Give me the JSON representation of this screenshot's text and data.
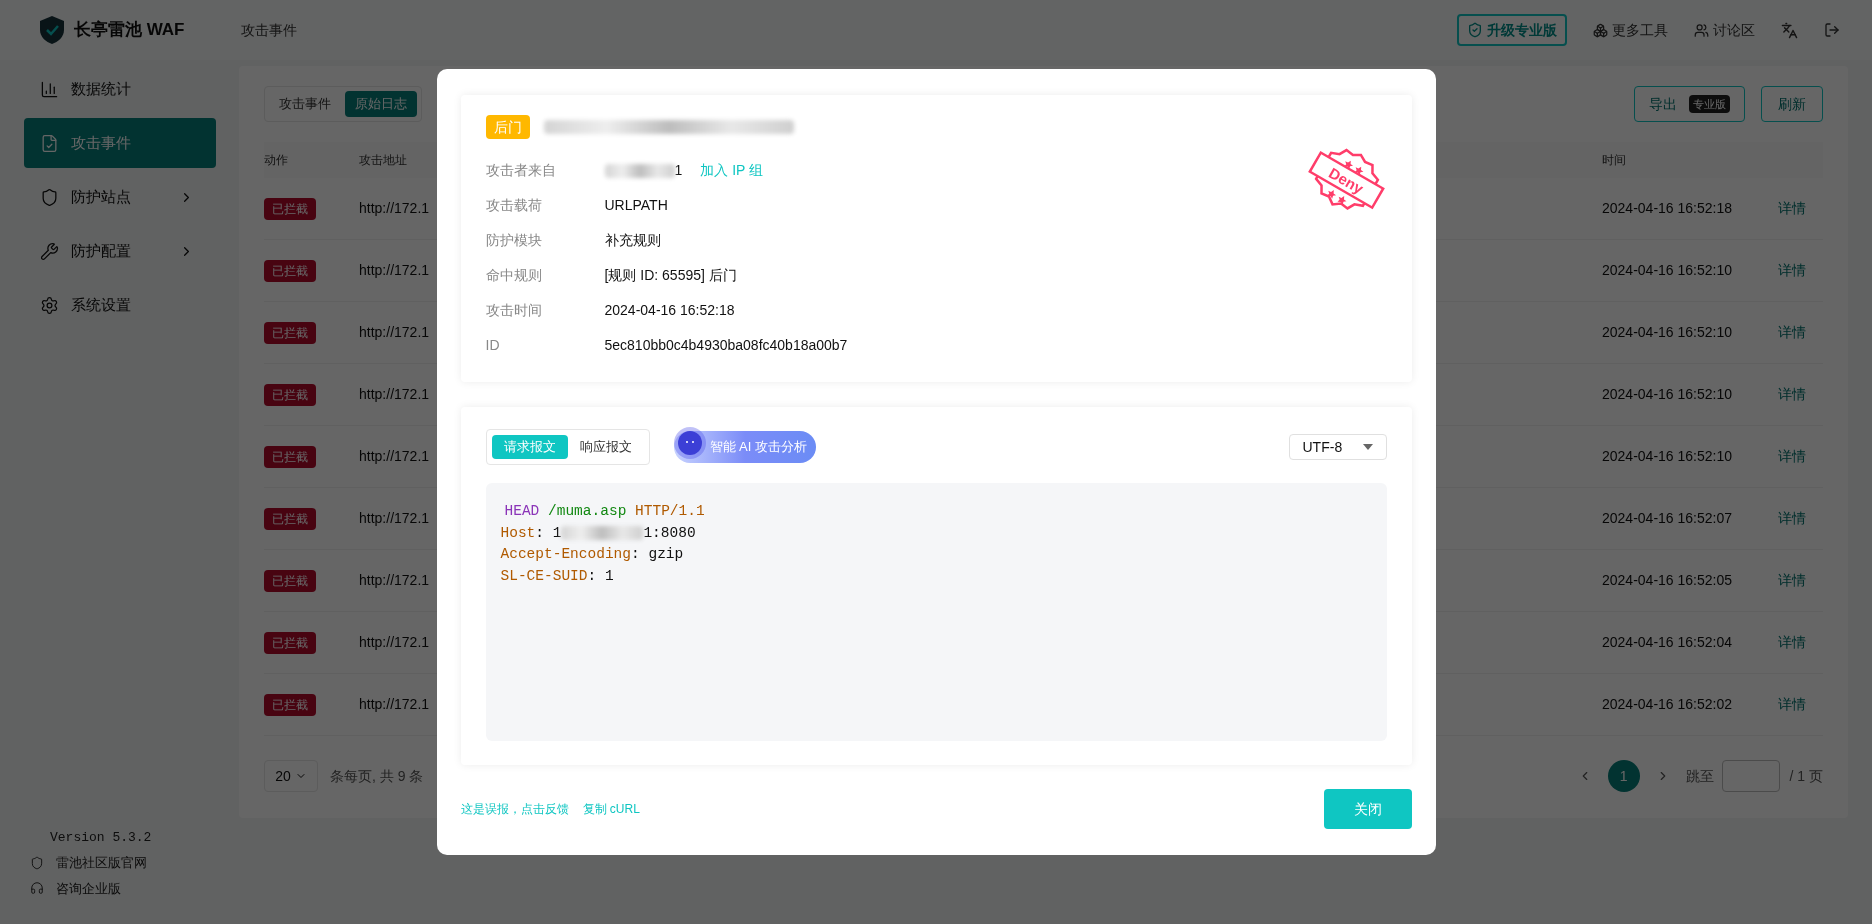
{
  "topbar": {
    "logo_text": "长亭雷池 WAF",
    "breadcrumb": "攻击事件",
    "actions": [
      {
        "kind": "upgrade",
        "label": "升级专业版"
      },
      {
        "kind": "tools",
        "label": "更多工具"
      },
      {
        "kind": "forum",
        "label": "讨论区"
      },
      {
        "kind": "language"
      },
      {
        "kind": "logout"
      }
    ]
  },
  "sidebar": {
    "items": [
      {
        "kind": "chart",
        "label": "数据统计",
        "expandable": false,
        "selected": false
      },
      {
        "kind": "file",
        "label": "攻击事件",
        "expandable": false,
        "selected": true
      },
      {
        "kind": "shield",
        "label": "防护站点",
        "expandable": true,
        "selected": false
      },
      {
        "kind": "tools",
        "label": "防护配置",
        "expandable": true,
        "selected": false
      },
      {
        "kind": "gear",
        "label": "系统设置",
        "expandable": false,
        "selected": false
      }
    ],
    "version": "Version 5.3.2",
    "links": [
      {
        "kind": "shield",
        "label": "雷池社区版官网"
      },
      {
        "kind": "headset",
        "label": "咨询企业版"
      }
    ]
  },
  "toolbar": {
    "tabs": [
      {
        "label": "攻击事件",
        "selected": false
      },
      {
        "label": "原始日志",
        "selected": true
      }
    ],
    "export": {
      "label": "导出",
      "badge": "专业版"
    },
    "refresh": "刷新"
  },
  "table": {
    "columns": [
      {
        "label": "动作"
      },
      {
        "label": "攻击地址"
      },
      {
        "label": "时间"
      }
    ],
    "rows": [
      {
        "action": "已拦截",
        "address": "http://172.1",
        "time": "2024-04-16 16:52:18",
        "link": "详情"
      },
      {
        "action": "已拦截",
        "address": "http://172.1",
        "time": "2024-04-16 16:52:10",
        "link": "详情"
      },
      {
        "action": "已拦截",
        "address": "http://172.1",
        "time": "2024-04-16 16:52:10",
        "link": "详情"
      },
      {
        "action": "已拦截",
        "address": "http://172.1",
        "time": "2024-04-16 16:52:10",
        "link": "详情"
      },
      {
        "action": "已拦截",
        "address": "http://172.1",
        "time": "2024-04-16 16:52:10",
        "link": "详情"
      },
      {
        "action": "已拦截",
        "address": "http://172.1",
        "time": "2024-04-16 16:52:07",
        "link": "详情"
      },
      {
        "action": "已拦截",
        "address": "http://172.1",
        "time": "2024-04-16 16:52:05",
        "link": "详情"
      },
      {
        "action": "已拦截",
        "address": "http://172.1",
        "time": "2024-04-16 16:52:04",
        "link": "详情"
      },
      {
        "action": "已拦截",
        "address": "http://172.1",
        "time": "2024-04-16 16:52:02",
        "link": "详情"
      }
    ]
  },
  "pagination": {
    "page_size": "20",
    "summary": "条每页, 共 9 条",
    "pages": [
      {
        "label": "1",
        "selected": true
      }
    ],
    "jump_label": "跳至",
    "total": "/ 1 页"
  },
  "modal": {
    "tag": "后门",
    "title_redacted": true,
    "details": [
      {
        "kind": "ip",
        "label": "攻击者来自",
        "value": "1",
        "redacted": true,
        "link": "加入 IP 组"
      },
      {
        "kind": "text",
        "label": "攻击载荷",
        "value": "URLPATH"
      },
      {
        "kind": "text",
        "label": "防护模块",
        "value": "补充规则"
      },
      {
        "kind": "text",
        "label": "命中规则",
        "value": "[规则 ID: 65595] 后门"
      },
      {
        "kind": "text",
        "label": "攻击时间",
        "value": "2024-04-16 16:52:18"
      },
      {
        "kind": "text",
        "label": "ID",
        "value": "5ec810bb0c4b4930ba08fc40b18a00b7"
      }
    ],
    "stamp": "Deny",
    "tabs": [
      {
        "label": "请求报文",
        "selected": true
      },
      {
        "label": "响应报文",
        "selected": false
      }
    ],
    "ai_button": "智能 AI 攻击分析",
    "encoding": "UTF-8",
    "request": [
      {
        "kind": "request_line",
        "method": "HEAD",
        "path": "/muma.asp",
        "version": "HTTP/1.1"
      },
      {
        "kind": "header",
        "name": "Host",
        "separator": ":",
        "value_prefix": "1",
        "redacted": true,
        "value": "1:8080"
      },
      {
        "kind": "header",
        "name": "Accept-Encoding",
        "separator": ":",
        "value": "gzip",
        "redacted": false
      },
      {
        "kind": "header",
        "name": "SL-CE-SUID",
        "separator": ":",
        "value": "1",
        "redacted": false
      }
    ],
    "links": [
      "这是误报，点击反馈",
      "复制 cURL"
    ],
    "close": "关闭"
  }
}
